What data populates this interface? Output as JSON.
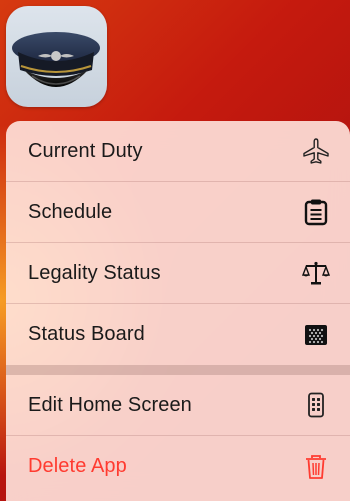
{
  "app": {
    "icon": "pilot-cap-icon"
  },
  "menu": {
    "shortcuts": [
      {
        "label": "Current Duty",
        "icon": "airplane-icon"
      },
      {
        "label": "Schedule",
        "icon": "clipboard-list-icon"
      },
      {
        "label": "Legality Status",
        "icon": "scales-icon"
      },
      {
        "label": "Status Board",
        "icon": "status-board-grid-icon"
      }
    ],
    "system": [
      {
        "label": "Edit Home Screen",
        "icon": "phone-apps-icon"
      },
      {
        "label": "Delete App",
        "icon": "trash-icon"
      }
    ]
  },
  "colors": {
    "destructive": "#ff3b30",
    "text": "#1a1a1a",
    "background_red": "#c51a0e",
    "background_orange": "#ffb428"
  }
}
